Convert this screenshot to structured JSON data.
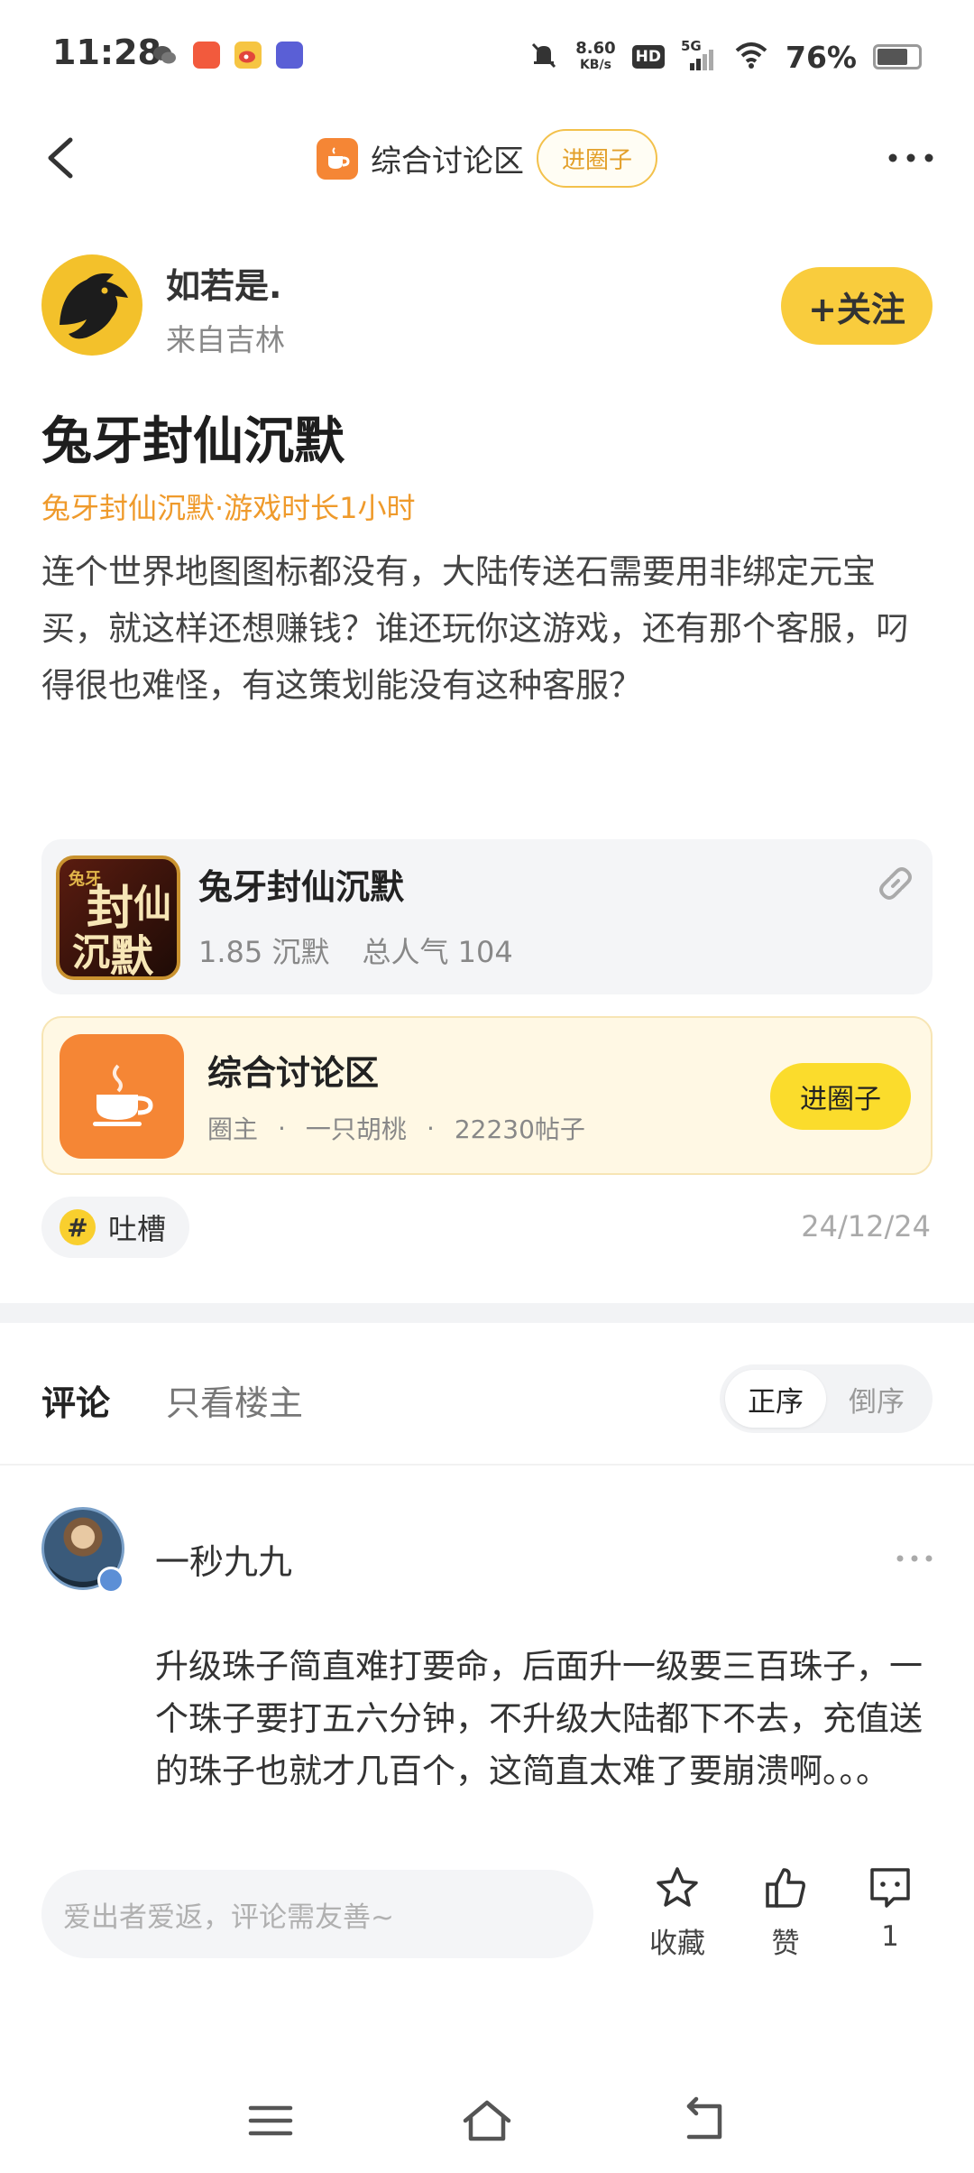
{
  "status_bar": {
    "time": "11:28",
    "net_speed_value": "8.60",
    "net_speed_unit": "KB/s",
    "hd": "HD",
    "signal": "5G",
    "battery_text": "76%",
    "battery_level": 0.76
  },
  "nav": {
    "title": "综合讨论区",
    "join_label": "进圈子",
    "accent": "#f58635"
  },
  "author": {
    "name": "如若是.",
    "location": "来自吉林",
    "follow_label": "+关注"
  },
  "post": {
    "title": "兔牙封仙沉默",
    "tag_line": "兔牙封仙沉默·游戏时长1小时",
    "body": "连个世界地图图标都没有，大陆传送石需要用非绑定元宝买，就这样还想赚钱？谁还玩你这游戏，还有那个客服，叼得很也难怪，有这策划能没有这种客服？",
    "topic": "吐槽",
    "date": "24/12/24"
  },
  "game_card": {
    "name": "兔牙封仙沉默",
    "version": "1.85 沉默",
    "popularity": "总人气 104"
  },
  "circle_card": {
    "name": "综合讨论区",
    "owner_label": "圈主",
    "owner_name": "一只胡桃",
    "post_count": "22230帖子",
    "join_label": "进圈子"
  },
  "comments": {
    "tab_all": "评论",
    "tab_owner": "只看楼主",
    "sort_asc": "正序",
    "sort_desc": "倒序",
    "items": [
      {
        "user": "一秒九九",
        "text": "升级珠子简直难打要命，后面升一级要三百珠子，一个珠子要打五六分钟，不升级大陆都下不去，充值送的珠子也就才几百个，这简直太难了要崩溃啊。。。"
      }
    ]
  },
  "bottom_bar": {
    "input_placeholder": "爱出者爱返，评论需友善~",
    "favorite_label": "收藏",
    "like_label": "赞",
    "comment_count": "1"
  }
}
